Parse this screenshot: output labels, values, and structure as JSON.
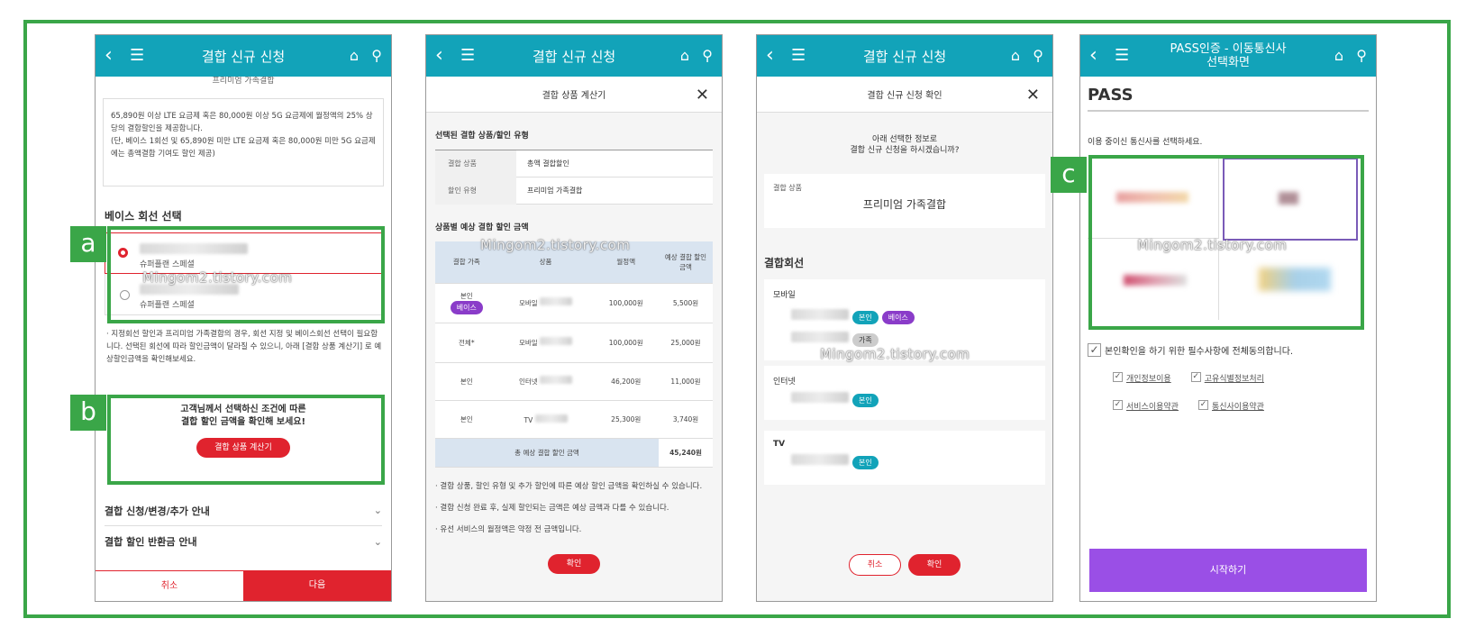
{
  "screens": {
    "s1": {
      "title": "결합 신규 신청",
      "top_cut": "프리미엄 가족결합",
      "desc": "65,890원 이상 LTE 요금제 혹은 80,000원 이상 5G 요금제에 월정액의 25% 상당의 결합할인을 제공합니다.",
      "desc_note": "(단, 베이스 1회선 및 65,890원 미만 LTE 요금제 혹은 80,000원 미만 5G 요금제에는 총액결합 기여도 할인 제공)",
      "base_title": "베이스 회선 선택",
      "option1": "슈퍼플랜 스페셜",
      "option2": "슈퍼플랜 스페셜",
      "notice": "· 지정회선 할인과 프리미엄 가족결합의 경우, 회선 지정 및 베이스회선 선택이 필요합니다. 선택된 회선에 따라 할인금액이 달라질 수 있으니, 아래 [결합 상품 계산기] 로 예상할인금액을 확인해보세요.",
      "calc_line1": "고객님께서 선택하신 조건에 따른",
      "calc_line2": "결합 할인 금액을 확인해 보세요!",
      "calc_button": "결합 상품 계산기",
      "acc1": "결합 신청/변경/추가 안내",
      "acc2": "결합 할인 반환금 안내",
      "cancel": "취소",
      "next": "다음"
    },
    "s2": {
      "title": "결합 신규 신청",
      "sub_title": "결합 상품 계산기",
      "sec1": "선택된 결합 상품/할인 유형",
      "row1_label": "결합 상품",
      "row1_value": "총액 결합할인",
      "row2_label": "할인 유형",
      "row2_value": "프리미엄 가족결합",
      "sec2": "상품별 예상 결합 할인 금액",
      "headers": [
        "결합 가족",
        "상품",
        "월정액",
        "예상 결합 할인 금액"
      ],
      "rows": [
        {
          "family": "본인",
          "tag": "베이스",
          "product": "모바일",
          "monthly": "100,000원",
          "discount": "5,500원"
        },
        {
          "family": "전체*",
          "tag": "",
          "product": "모바일",
          "monthly": "100,000원",
          "discount": "25,000원"
        },
        {
          "family": "본인",
          "tag": "",
          "product": "인터넷",
          "monthly": "46,200원",
          "discount": "11,000원"
        },
        {
          "family": "본인",
          "tag": "",
          "product": "TV",
          "monthly": "25,300원",
          "discount": "3,740원"
        }
      ],
      "total_label": "총 예상 결합 할인 금액",
      "total_value": "45,240원",
      "note1": "· 결합 상품, 할인 유형 및 추가 할인에 따른 예상 할인 금액을 확인하실 수 있습니다.",
      "note2": "· 결합 신청 완료 후, 실제 할인되는 금액은 예상 금액과 다를 수 있습니다.",
      "note3": "· 유선 서비스의 월정액은 약정 전 금액입니다.",
      "confirm": "확인"
    },
    "s3": {
      "title": "결합 신규 신청",
      "sub_title": "결합 신규 신청 확인",
      "question1": "아래 선택한 정보로",
      "question2": "결합 신규 신청을 하시겠습니까?",
      "product_label": "결합 상품",
      "product_value": "프리미엄 가족결합",
      "lines_title": "결합회선",
      "mobile": "모바일",
      "tag_self": "본인",
      "tag_base": "베이스",
      "tag_family": "가족",
      "internet": "인터넷",
      "tv": "TV",
      "cancel": "취소",
      "confirm": "확인"
    },
    "s4": {
      "title_line1": "PASS인증 - 이동통신사",
      "title_line2": "선택화면",
      "logo": "PASS",
      "prompt": "이용 중이신 통신사를 선택하세요.",
      "agree_all": "본인확인을 하기 위한 필수사항에 전체동의합니다.",
      "term1": "개인정보이용",
      "term2": "고유식별정보처리",
      "term3": "서비스이용약관",
      "term4": "통신사이용약관",
      "start": "시작하기"
    }
  },
  "labels": {
    "a": "a",
    "b": "b",
    "c": "c"
  },
  "watermark": "Mingom2.tistory.com",
  "colors": {
    "frame_green": "#3aa648",
    "header_teal": "#12a3b9",
    "red": "#e0232e",
    "purple": "#8a3cc9"
  }
}
